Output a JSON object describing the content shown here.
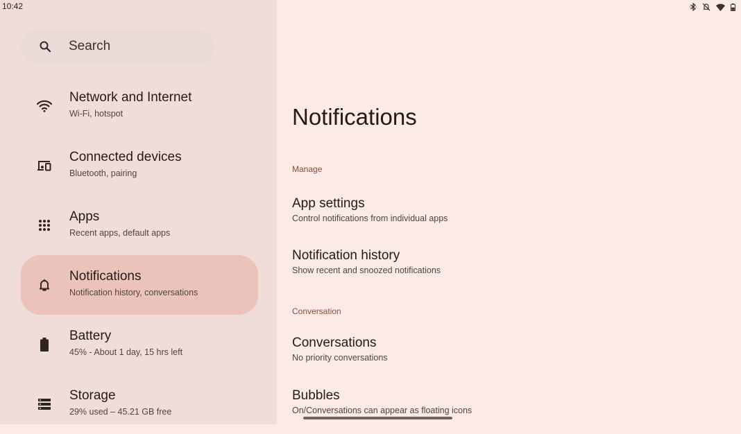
{
  "status_bar": {
    "time": "10:42",
    "icons": [
      "bluetooth-icon",
      "muted-icon",
      "wifi-icon",
      "battery-icon"
    ]
  },
  "search": {
    "label": "Search",
    "icon": "search-icon"
  },
  "sidebar": {
    "items": [
      {
        "title": "Network and Internet",
        "subtitle": "Wi-Fi, hotspot",
        "icon": "wifi-icon"
      },
      {
        "title": "Connected devices",
        "subtitle": "Bluetooth, pairing",
        "icon": "connected-devices-icon"
      },
      {
        "title": "Apps",
        "subtitle": "Recent apps, default apps",
        "icon": "apps-grid-icon"
      },
      {
        "title": "Notifications",
        "subtitle": "Notification history, conversations",
        "icon": "bell-icon",
        "selected": true
      },
      {
        "title": "Battery",
        "subtitle": "45% - About 1 day, 15 hrs left",
        "icon": "battery-icon"
      },
      {
        "title": "Storage",
        "subtitle": "29% used – 45.21 GB free",
        "icon": "storage-icon"
      }
    ]
  },
  "main": {
    "title": "Notifications",
    "sections": [
      {
        "header": "Manage",
        "items": [
          {
            "title": "App settings",
            "subtitle": "Control notifications from individual apps"
          },
          {
            "title": "Notification history",
            "subtitle": "Show recent and snoozed notifications"
          }
        ]
      },
      {
        "header": "Conversation",
        "items": [
          {
            "title": "Conversations",
            "subtitle": "No priority conversations"
          },
          {
            "title": "Bubbles",
            "subtitle": "On/Conversations can appear as floating icons"
          }
        ]
      }
    ]
  },
  "colors": {
    "sidebar_bg": "#f0dcd8",
    "main_bg": "#fbeae6",
    "selected_bg": "#ebc3bb",
    "search_bg": "#e8dbd8",
    "section_header": "#8b4a3c"
  }
}
